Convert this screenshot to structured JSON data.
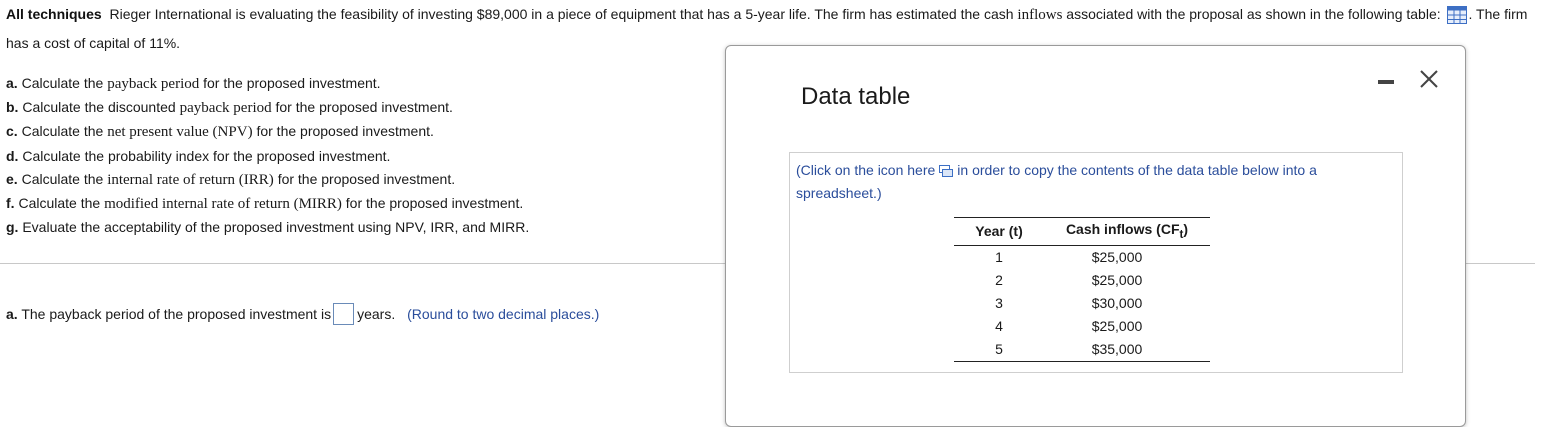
{
  "intro": {
    "heading": "All techniques",
    "text_1": "Rieger International is evaluating the feasibility of investing $89,000 in a piece of equipment that has a 5-year life. The firm has estimated the cash",
    "term_inflows": "inflows",
    "text_2": "associated with the proposal as shown in the following table:",
    "text_3": ". The firm has a cost of capital of 11%."
  },
  "questions": [
    {
      "letter": "a.",
      "pre": "Calculate the",
      "term": "payback period",
      "post": "for the proposed investment."
    },
    {
      "letter": "b.",
      "pre": "Calculate the discounted",
      "term": "payback period",
      "post": "for the proposed investment."
    },
    {
      "letter": "c.",
      "pre": "Calculate the",
      "term": "net present value (NPV)",
      "post": "for the proposed investment."
    },
    {
      "letter": "d.",
      "pre": "Calculate the probability index for the proposed investment.",
      "term": "",
      "post": ""
    },
    {
      "letter": "e.",
      "pre": "Calculate the",
      "term": "internal rate of return (IRR)",
      "post": "for the proposed investment."
    },
    {
      "letter": "f.",
      "pre": "Calculate the",
      "term": "modified internal rate of return (MIRR)",
      "post": "for the proposed investment."
    },
    {
      "letter": "g.",
      "pre": "Evaluate the acceptability of the proposed investment using NPV, IRR, and MIRR.",
      "term": "",
      "post": ""
    }
  ],
  "answer": {
    "letter": "a.",
    "prompt": "The payback period of the proposed investment is",
    "value": "",
    "unit": "years.",
    "hint": "(Round to two decimal places.)"
  },
  "modal": {
    "title": "Data table",
    "copy_note_pre": "(Click on the icon here",
    "copy_note_post": "in order to copy the contents of the data table below into a spreadsheet.)",
    "table": {
      "col_year": "Year (t)",
      "col_cash": "Cash inflows (CF",
      "col_cash_sub": "t",
      "col_cash_close": ")",
      "rows": [
        {
          "year": "1",
          "cash": "$25,000"
        },
        {
          "year": "2",
          "cash": "$25,000"
        },
        {
          "year": "3",
          "cash": "$30,000"
        },
        {
          "year": "4",
          "cash": "$25,000"
        },
        {
          "year": "5",
          "cash": "$35,000"
        }
      ]
    }
  },
  "colors": {
    "link_blue": "#2a4d9b",
    "icon_blue": "#3d6fc4"
  },
  "icons": {
    "table": "grid-table-icon",
    "copy": "copy-icon",
    "minimize": "minimize-icon",
    "close": "close-icon"
  }
}
